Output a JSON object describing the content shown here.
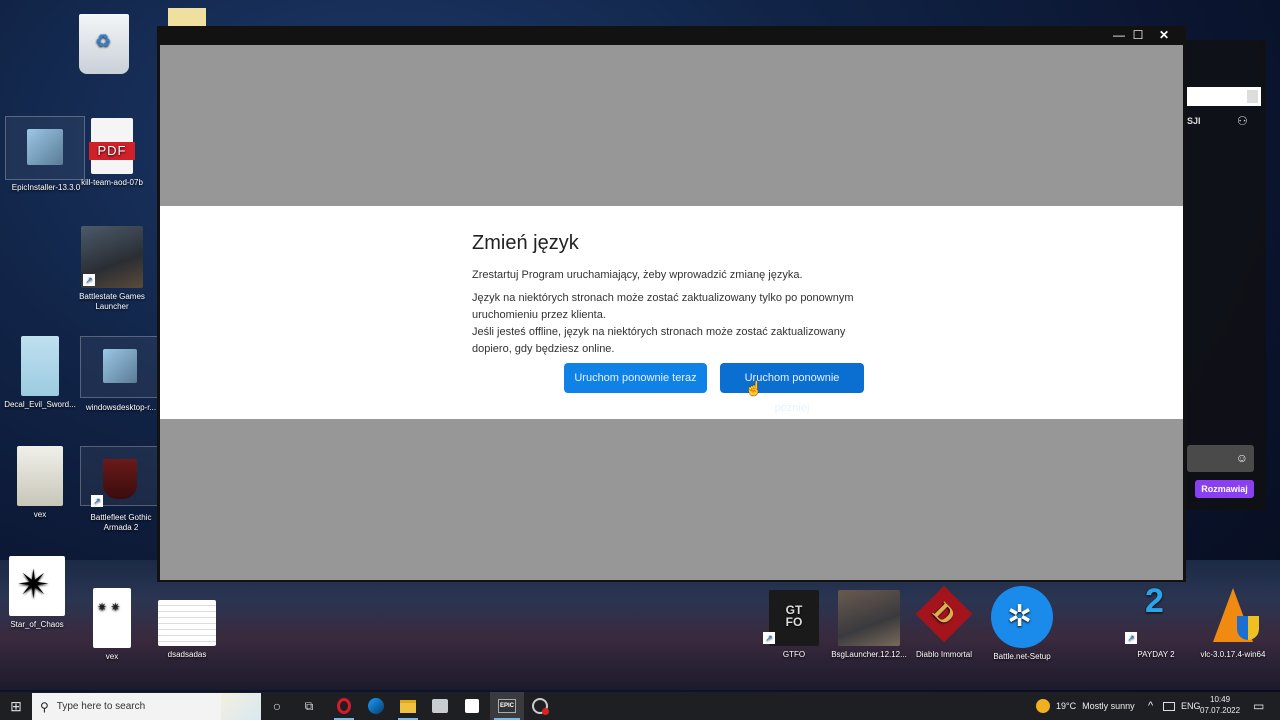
{
  "desktop": {
    "icons": [
      {
        "label": "",
        "name": "recycle-bin"
      },
      {
        "label": "EpicInstaller-13.3.0"
      },
      {
        "label": "kill-team-aod-07b"
      },
      {
        "label": "Battlestate Games Launcher"
      },
      {
        "label": "Decal_Evil_Sword..."
      },
      {
        "label": "windowsdesktop-r..."
      },
      {
        "label": "vex"
      },
      {
        "label": "Battlefleet Gothic Armada 2"
      },
      {
        "label": "Star_of_Chaos"
      },
      {
        "label": "vex"
      },
      {
        "label": "dsadsadas"
      },
      {
        "label": "GTFO"
      },
      {
        "label": "BsgLauncher.12.12..."
      },
      {
        "label": "Diablo Immortal"
      },
      {
        "label": "Battle.net-Setup"
      },
      {
        "label": "PAYDAY 2"
      },
      {
        "label": "vlc-3.0.17.4-win64"
      }
    ],
    "pdf_badge": "PDF",
    "gtfo_logo": "GT FO",
    "payday_logo": "2",
    "diablo_logo": "D"
  },
  "window": {
    "controls": {
      "minimize": "—",
      "maximize": "☐",
      "close": "✕"
    }
  },
  "dialog": {
    "title": "Zmień język",
    "line1": "Zrestartuj Program uruchamiający, żeby wprowadzić zmianę języka.",
    "line2": "Język na niektórych stronach może zostać zaktualizowany tylko po ponownym uruchomieniu przez klienta.",
    "line3": "Jeśli jesteś offline, język na niektórych stronach może zostać zaktualizowany dopiero, gdy będziesz online.",
    "restart_now": "Uruchom ponownie teraz",
    "restart_later": "Uruchom ponownie później"
  },
  "side_panel": {
    "label": "SJI",
    "friends_icon": "⚇",
    "emoji_icon": "☺",
    "chat_button": "Rozmawiaj"
  },
  "taskbar": {
    "start_icon": "⊞",
    "search_placeholder": "Type here to search",
    "search_icon": "⚲",
    "cortana_icon": "○",
    "taskview_icon": "⧉",
    "weather_temp": "19°C",
    "weather_text": "Mostly sunny",
    "tray_chevron": "^",
    "language": "ENG",
    "time": "10:49",
    "date": "07.07.2022",
    "notification_icon": "▭",
    "epic_label": "EPIC"
  }
}
